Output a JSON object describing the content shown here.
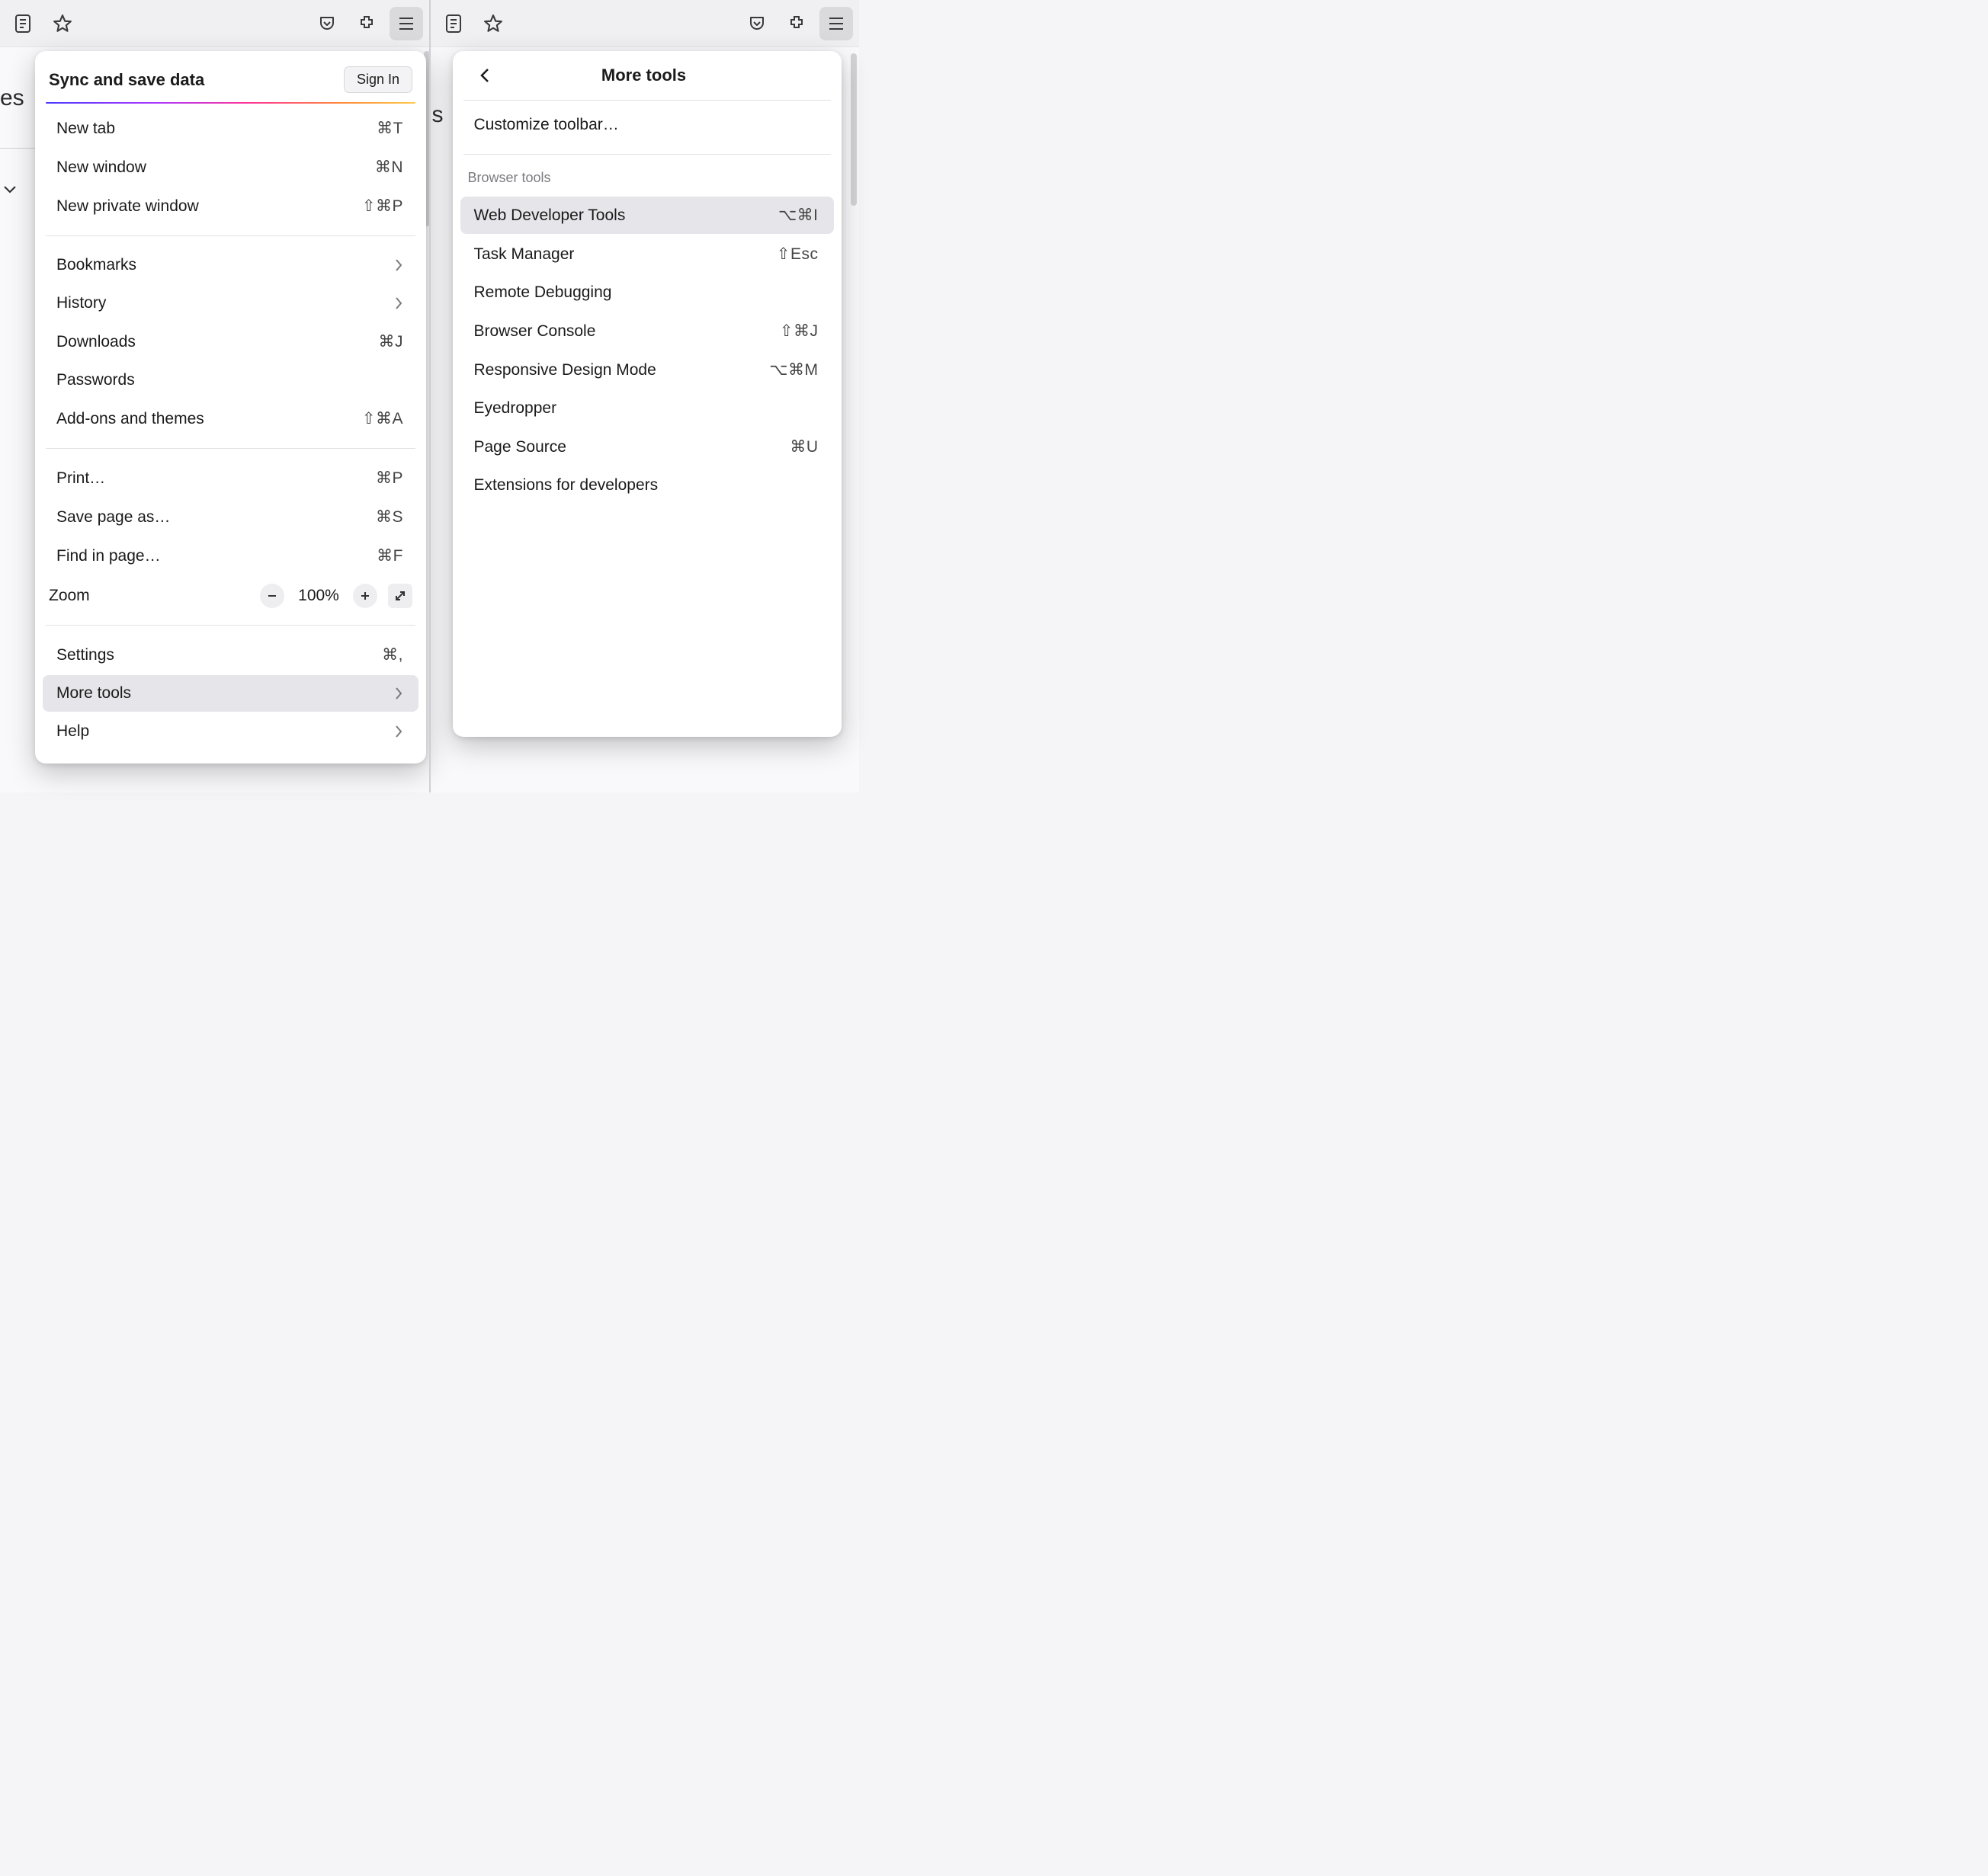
{
  "toolbar": {
    "icons": [
      "reader",
      "star",
      "pocket",
      "extensions",
      "menu"
    ]
  },
  "bg_left": {
    "fragment": "es"
  },
  "bg_right": {
    "fragment": "s"
  },
  "left_menu": {
    "sync_title": "Sync and save data",
    "sign_in": "Sign In",
    "new_tab": {
      "label": "New tab",
      "shortcut": "⌘T"
    },
    "new_window": {
      "label": "New window",
      "shortcut": "⌘N"
    },
    "new_private": {
      "label": "New private window",
      "shortcut": "⇧⌘P"
    },
    "bookmarks": {
      "label": "Bookmarks"
    },
    "history": {
      "label": "History"
    },
    "downloads": {
      "label": "Downloads",
      "shortcut": "⌘J"
    },
    "passwords": {
      "label": "Passwords"
    },
    "addons": {
      "label": "Add-ons and themes",
      "shortcut": "⇧⌘A"
    },
    "print": {
      "label": "Print…",
      "shortcut": "⌘P"
    },
    "save_as": {
      "label": "Save page as…",
      "shortcut": "⌘S"
    },
    "find": {
      "label": "Find in page…",
      "shortcut": "⌘F"
    },
    "zoom": {
      "label": "Zoom",
      "percent": "100%"
    },
    "settings": {
      "label": "Settings",
      "shortcut": "⌘,"
    },
    "more_tools": {
      "label": "More tools"
    },
    "help": {
      "label": "Help"
    }
  },
  "right_menu": {
    "title": "More tools",
    "customize": {
      "label": "Customize toolbar…"
    },
    "section_label": "Browser tools",
    "web_dev": {
      "label": "Web Developer Tools",
      "shortcut": "⌥⌘I"
    },
    "task_mgr": {
      "label": "Task Manager",
      "shortcut": "⇧Esc"
    },
    "remote_dbg": {
      "label": "Remote Debugging"
    },
    "console": {
      "label": "Browser Console",
      "shortcut": "⇧⌘J"
    },
    "rdm": {
      "label": "Responsive Design Mode",
      "shortcut": "⌥⌘M"
    },
    "eyedropper": {
      "label": "Eyedropper"
    },
    "page_source": {
      "label": "Page Source",
      "shortcut": "⌘U"
    },
    "ext_dev": {
      "label": "Extensions for developers"
    }
  }
}
